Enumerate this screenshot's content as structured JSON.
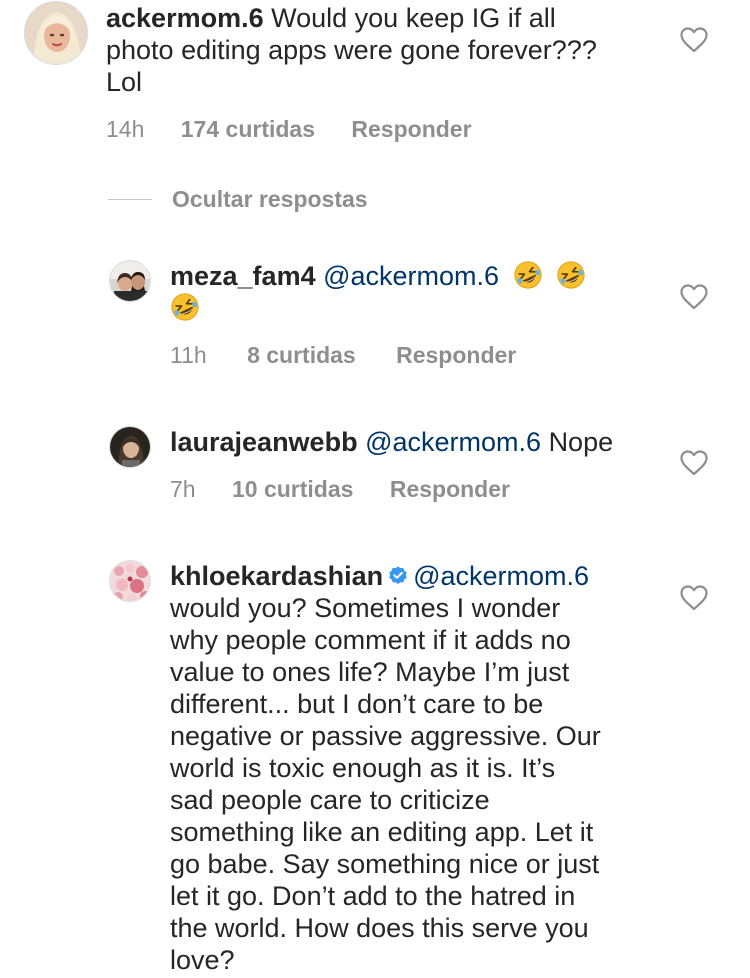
{
  "comments": [
    {
      "username": "ackermom.6",
      "mention": "",
      "text": "Would you keep IG if all photo editing apps were gone forever??? Lol",
      "line1": "Would you keep IG if all",
      "line2": "photo editing apps were gone forever???",
      "line3": "Lol",
      "time": "14h",
      "likes": "174 curtidas",
      "reply": "Responder"
    },
    {
      "username": "meza_fam4",
      "mention": "@ackermom.6",
      "emoji": "rolling-on-floor-laughing",
      "time": "11h",
      "likes": "8 curtidas",
      "reply": "Responder"
    },
    {
      "username": "laurajeanwebb",
      "mention": "@ackermom.6",
      "text": "Nope",
      "time": "7h",
      "likes": "10 curtidas",
      "reply": "Responder"
    },
    {
      "username": "khloekardashian",
      "verified": true,
      "mention": "@ackermom.6",
      "lines": [
        "would you? Sometimes I wonder",
        "why people comment if it adds no",
        "value to ones life? Maybe I’m just",
        "different... but I don’t care to be",
        "negative or passive aggressive. Our",
        "world is toxic enough as it is. It’s",
        "sad people care to criticize",
        "something like an editing app. Let it",
        "go babe. Say something nice or just",
        "let it go. Don’t add to the hatred in",
        "the world. How does this serve you",
        "love?"
      ]
    }
  ],
  "hide_replies_label": "Ocultar respostas",
  "icons": {
    "heart": "heart-outline-icon",
    "verified": "verified-badge-icon",
    "emoji": "rolling-on-floor-laughing-emoji"
  },
  "colors": {
    "text": "#262626",
    "secondary": "#8e8e8e",
    "mention": "#003569",
    "verified": "#3897f0"
  }
}
